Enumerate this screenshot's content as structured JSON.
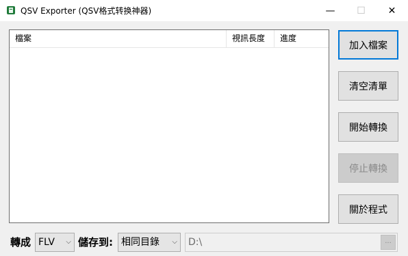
{
  "window": {
    "title": "QSV Exporter (QSV格式转换神器)",
    "minimize_glyph": "—",
    "maximize_glyph": "☐",
    "close_glyph": "✕"
  },
  "list": {
    "columns": [
      "檔案",
      "視訊長度",
      "進度"
    ],
    "rows": []
  },
  "buttons": {
    "add_files": "加入檔案",
    "clear_list": "清空清單",
    "start_convert": "開始轉換",
    "stop_convert": "停止轉換",
    "about": "關於程式"
  },
  "bottom": {
    "convert_label": "轉成",
    "format_value": "FLV",
    "save_label": "儲存到:",
    "destination_value": "相同目錄",
    "path_value": "D:\\",
    "browse_label": "..."
  },
  "colors": {
    "focus_border": "#0078d7",
    "disabled_bg": "#cccccc",
    "window_bg": "#f0f0f0"
  }
}
